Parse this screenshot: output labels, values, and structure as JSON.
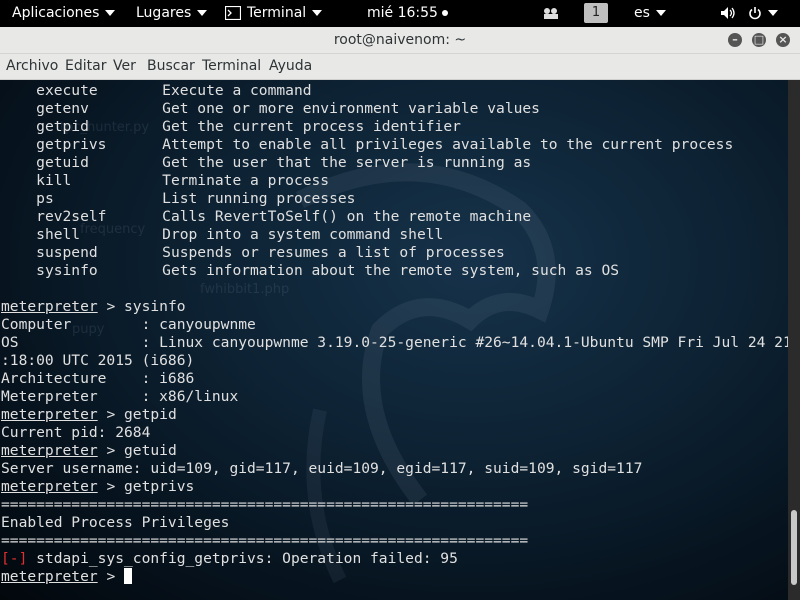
{
  "topbar": {
    "apps": "Aplicaciones",
    "places": "Lugares",
    "terminal": "Terminal",
    "clock": "mié 16:55",
    "workspace": "1",
    "lang": "es"
  },
  "window": {
    "title": "root@naivenom: ~"
  },
  "menubar": {
    "items": [
      "Archivo",
      "Editar",
      "Ver",
      "Buscar",
      "Terminal",
      "Ayuda"
    ]
  },
  "terminal": {
    "cmd_rows": [
      {
        "name": "execute",
        "desc": "Execute a command"
      },
      {
        "name": "getenv",
        "desc": "Get one or more environment variable values"
      },
      {
        "name": "getpid",
        "desc": "Get the current process identifier"
      },
      {
        "name": "getprivs",
        "desc": "Attempt to enable all privileges available to the current process"
      },
      {
        "name": "getuid",
        "desc": "Get the user that the server is running as"
      },
      {
        "name": "kill",
        "desc": "Terminate a process"
      },
      {
        "name": "ps",
        "desc": "List running processes"
      },
      {
        "name": "rev2self",
        "desc": "Calls RevertToSelf() on the remote machine"
      },
      {
        "name": "shell",
        "desc": "Drop into a system command shell"
      },
      {
        "name": "suspend",
        "desc": "Suspends or resumes a list of processes"
      },
      {
        "name": "sysinfo",
        "desc": "Gets information about the remote system, such as OS"
      }
    ],
    "prompt": "meterpreter",
    "prompt_sep": " > ",
    "cmd_sysinfo": "sysinfo",
    "info_computer": "Computer        : canyoupwnme",
    "info_os_1": "OS              : Linux canyoupwnme 3.19.0-25-generic #26~14.04.1-Ubuntu SMP Fri Jul 24 21",
    "info_os_2": ":18:00 UTC 2015 (i686)",
    "info_arch": "Architecture    : i686",
    "info_meterp": "Meterpreter     : x86/linux",
    "cmd_getpid": "getpid",
    "out_pid": "Current pid: 2684",
    "cmd_getuid": "getuid",
    "out_uid": "Server username: uid=109, gid=117, euid=109, egid=117, suid=109, sgid=117",
    "cmd_getprivs": "getprivs",
    "separator": "============================================================",
    "privs_header": "Enabled Process Privileges",
    "err_tag": "[-]",
    "err_msg": " stdapi_sys_config_getprivs: Operation failed: 95"
  },
  "watermark": [
    "tpc_hunter.py",
    "frequency",
    "fwhibbit1.php",
    "pupy"
  ]
}
